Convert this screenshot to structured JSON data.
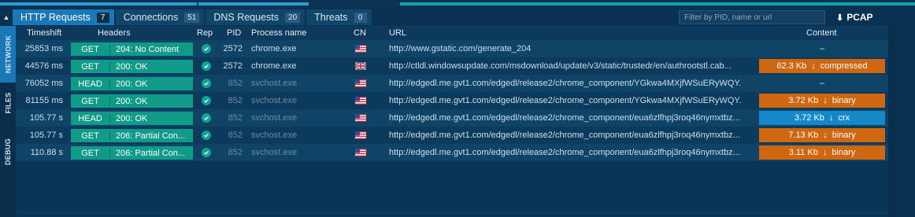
{
  "tabs": [
    {
      "label": "HTTP Requests",
      "count": "7"
    },
    {
      "label": "Connections",
      "count": "51"
    },
    {
      "label": "DNS Requests",
      "count": "20"
    },
    {
      "label": "Threats",
      "count": "0"
    }
  ],
  "filter": {
    "placeholder": "Filter by PID, name or url"
  },
  "pcap": {
    "label": "PCAP"
  },
  "sidebar": [
    "NETWORK",
    "FILES",
    "DEBUG"
  ],
  "columns": {
    "timeshift": "Timeshift",
    "headers": "Headers",
    "rep": "Rep",
    "pid": "PID",
    "process": "Process name",
    "cn": "CN",
    "url": "URL",
    "content": "Content"
  },
  "rows": [
    {
      "timeshift": "25853 ms",
      "method": "GET",
      "status": "204: No Content",
      "pid": "2572",
      "process": "chrome.exe",
      "country": "us-flag",
      "url": "http://www.gstatic.com/generate_204",
      "content": {
        "type": "none",
        "text": "–"
      }
    },
    {
      "timeshift": "44576 ms",
      "method": "GET",
      "status": "200: OK",
      "pid": "2572",
      "process": "chrome.exe",
      "country": "gb-flag",
      "url": "http://ctldl.windowsupdate.com/msdownload/update/v3/static/trustedr/en/authrootstl.cab...",
      "content": {
        "type": "orange",
        "size": "62.3 Kb",
        "kind": "compressed"
      }
    },
    {
      "timeshift": "76052 ms",
      "method": "HEAD",
      "status": "200: OK",
      "pid": "852",
      "process": "svchost.exe",
      "country": "us-flag",
      "url": "http://edgedl.me.gvt1.com/edgedl/release2/chrome_component/YGkwa4MXjfWSuERyWQY...",
      "content": {
        "type": "none",
        "text": "–"
      }
    },
    {
      "timeshift": "81155 ms",
      "method": "GET",
      "status": "200: OK",
      "pid": "852",
      "process": "svchost.exe",
      "country": "us-flag",
      "url": "http://edgedl.me.gvt1.com/edgedl/release2/chrome_component/YGkwa4MXjfWSuERyWQY...",
      "content": {
        "type": "orange",
        "size": "3.72 Kb",
        "kind": "binary"
      }
    },
    {
      "timeshift": "105.77 s",
      "method": "HEAD",
      "status": "200: OK",
      "pid": "852",
      "process": "svchost.exe",
      "country": "us-flag",
      "url": "http://edgedl.me.gvt1.com/edgedl/release2/chrome_component/eua6zlfhpj3roq46nymxtbz...",
      "content": {
        "type": "blue",
        "size": "3.72 Kb",
        "kind": "crx"
      }
    },
    {
      "timeshift": "105.77 s",
      "method": "GET",
      "status": "206: Partial Con...",
      "pid": "852",
      "process": "svchost.exe",
      "country": "us-flag",
      "url": "http://edgedl.me.gvt1.com/edgedl/release2/chrome_component/eua6zlfhpj3roq46nymxtbz...",
      "content": {
        "type": "orange",
        "size": "7.13 Kb",
        "kind": "binary"
      }
    },
    {
      "timeshift": "110.88 s",
      "method": "GET",
      "status": "206: Partial Con...",
      "pid": "852",
      "process": "svchost.exe",
      "country": "us-flag",
      "url": "http://edgedl.me.gvt1.com/edgedl/release2/chrome_component/eua6zlfhpj3roq46nymxtbz...",
      "content": {
        "type": "orange",
        "size": "3.11 Kb",
        "kind": "binary"
      }
    }
  ],
  "colors": {
    "active_tab": "#1a78b8",
    "pill": "#109a88",
    "orange_badge": "#cf6610",
    "blue_badge": "#1688c8",
    "background": "#0b3556"
  }
}
